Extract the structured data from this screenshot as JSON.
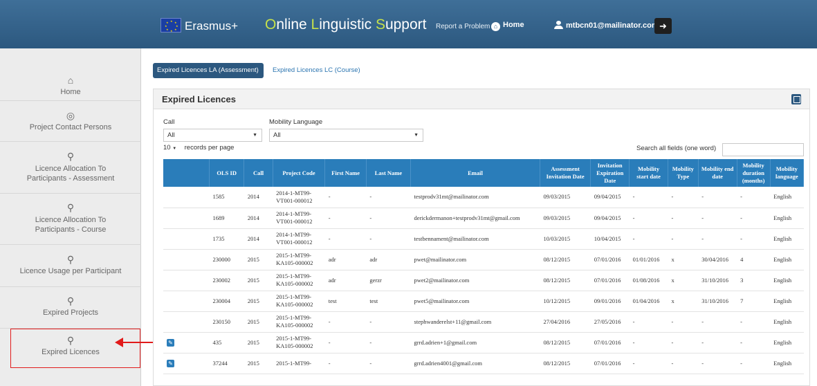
{
  "header": {
    "brand": "Erasmus+",
    "title_parts": [
      "O",
      "nline ",
      "L",
      "inguistic ",
      "S",
      "upport"
    ],
    "report": "Report a Problem",
    "home": "Home",
    "user": "mtbcn01@mailinator.com"
  },
  "sidebar": {
    "items": [
      {
        "label": "Home",
        "icon": "bank-icon"
      },
      {
        "label": "Project Contact Persons",
        "icon": "lifebuoy-icon"
      },
      {
        "label": "Licence Allocation To Participants - Assessment",
        "icon": "pin-icon"
      },
      {
        "label": "Licence Allocation To Participants - Course",
        "icon": "pin-icon"
      },
      {
        "label": "Licence Usage per Participant",
        "icon": "pin-icon"
      },
      {
        "label": "Expired Projects",
        "icon": "pin-icon"
      },
      {
        "label": "Expired Licences",
        "icon": "pin-icon"
      }
    ],
    "annotation_color": "#e11a1a"
  },
  "tabs": [
    "Expired Licences LA (Assessment)",
    "Expired Licences LC (Course)"
  ],
  "panel": {
    "title": "Expired Licences",
    "call_label": "Call",
    "call_value": "All",
    "lang_label": "Mobility Language",
    "lang_value": "All",
    "page_size": "10",
    "rpp_label": "records per page",
    "search_label": "Search all fields (one word)"
  },
  "table": {
    "columns": [
      "",
      "OLS ID",
      "Call",
      "Project Code",
      "First Name",
      "Last Name",
      "Email",
      "Assessment Invitation Date",
      "Invitation Expiration Date",
      "Mobility start date",
      "Mobility Type",
      "Mobility end date",
      "Mobility duration (months)",
      "Mobility language"
    ],
    "rows": [
      [
        "",
        "1585",
        "2014",
        "2014-1-MT99-VT001-000012",
        "-",
        "-",
        "testprodv31mt@mailinator.com",
        "09/03/2015",
        "09/04/2015",
        "-",
        "-",
        "-",
        "-",
        "English"
      ],
      [
        "",
        "1689",
        "2014",
        "2014-1-MT99-VT001-000012",
        "-",
        "-",
        "derickdermanon+testprodv31mt@gmail.com",
        "09/03/2015",
        "09/04/2015",
        "-",
        "-",
        "-",
        "-",
        "English"
      ],
      [
        "",
        "1735",
        "2014",
        "2014-1-MT99-VT001-000012",
        "-",
        "-",
        "testbennament@mailinator.com",
        "10/03/2015",
        "10/04/2015",
        "-",
        "-",
        "-",
        "-",
        "English"
      ],
      [
        "",
        "230000",
        "2015",
        "2015-1-MT99-KA105-000002",
        "adr",
        "adr",
        "pwet@mailinator.com",
        "08/12/2015",
        "07/01/2016",
        "01/01/2016",
        "x",
        "30/04/2016",
        "4",
        "English"
      ],
      [
        "",
        "230002",
        "2015",
        "2015-1-MT99-KA105-000002",
        "adr",
        "gerzr",
        "pwet2@mailinator.com",
        "08/12/2015",
        "07/01/2016",
        "01/08/2016",
        "x",
        "31/10/2016",
        "3",
        "English"
      ],
      [
        "",
        "230004",
        "2015",
        "2015-1-MT99-KA105-000002",
        "test",
        "test",
        "pwet5@mailinator.com",
        "10/12/2015",
        "09/01/2016",
        "01/04/2016",
        "x",
        "31/10/2016",
        "7",
        "English"
      ],
      [
        "",
        "230150",
        "2015",
        "2015-1-MT99-KA105-000002",
        "-",
        "-",
        "stephwanderelst+11@gmail.com",
        "27/04/2016",
        "27/05/2016",
        "-",
        "-",
        "-",
        "-",
        "English"
      ],
      [
        "edit",
        "435",
        "2015",
        "2015-1-MT99-KA105-000002",
        "-",
        "-",
        "grrd.adrien+1@gmail.com",
        "08/12/2015",
        "07/01/2016",
        "-",
        "-",
        "-",
        "-",
        "English"
      ],
      [
        "edit",
        "37244",
        "2015",
        "2015-1-MT99-",
        "-",
        "-",
        "grrd.adrien4001@gmail.com",
        "08/12/2015",
        "07/01/2016",
        "-",
        "-",
        "-",
        "-",
        "English"
      ]
    ]
  },
  "colors": {
    "header": "#2c587f",
    "accent": "#2a7dba",
    "title_highlight": "#c6e14b"
  }
}
